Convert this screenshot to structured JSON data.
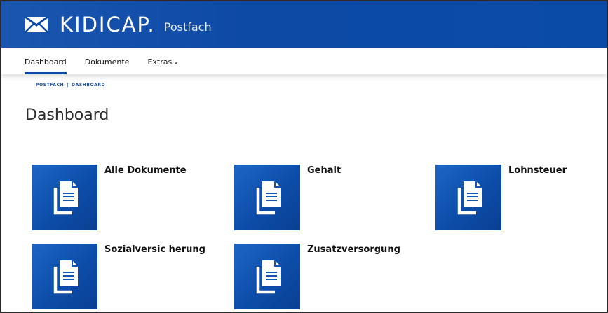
{
  "header": {
    "brand_name": "KIDICAP.",
    "brand_sub": "Postfach",
    "logo_icon": "envelope-icon",
    "background": "#0d4aa6"
  },
  "nav": {
    "items": [
      {
        "label": "Dashboard",
        "active": true
      },
      {
        "label": "Dokumente",
        "active": false
      },
      {
        "label": "Extras",
        "active": false,
        "icon": "chevron-down-icon"
      }
    ]
  },
  "breadcrumb": {
    "part1": "POSTFACH",
    "separator": "|",
    "part2": "DASHBOARD"
  },
  "page": {
    "title": "Dashboard"
  },
  "tiles": [
    {
      "label": "Alle Dokumente",
      "icon": "documents-icon"
    },
    {
      "label": "Gehalt",
      "icon": "documents-icon"
    },
    {
      "label": "Lohnsteuer",
      "icon": "documents-icon"
    },
    {
      "label": "Sozialversic herung",
      "icon": "documents-icon"
    },
    {
      "label": "Zusatzversorgung",
      "icon": "documents-icon"
    }
  ],
  "colors": {
    "accent": "#0d4aa6",
    "tile": "#1256b5"
  }
}
